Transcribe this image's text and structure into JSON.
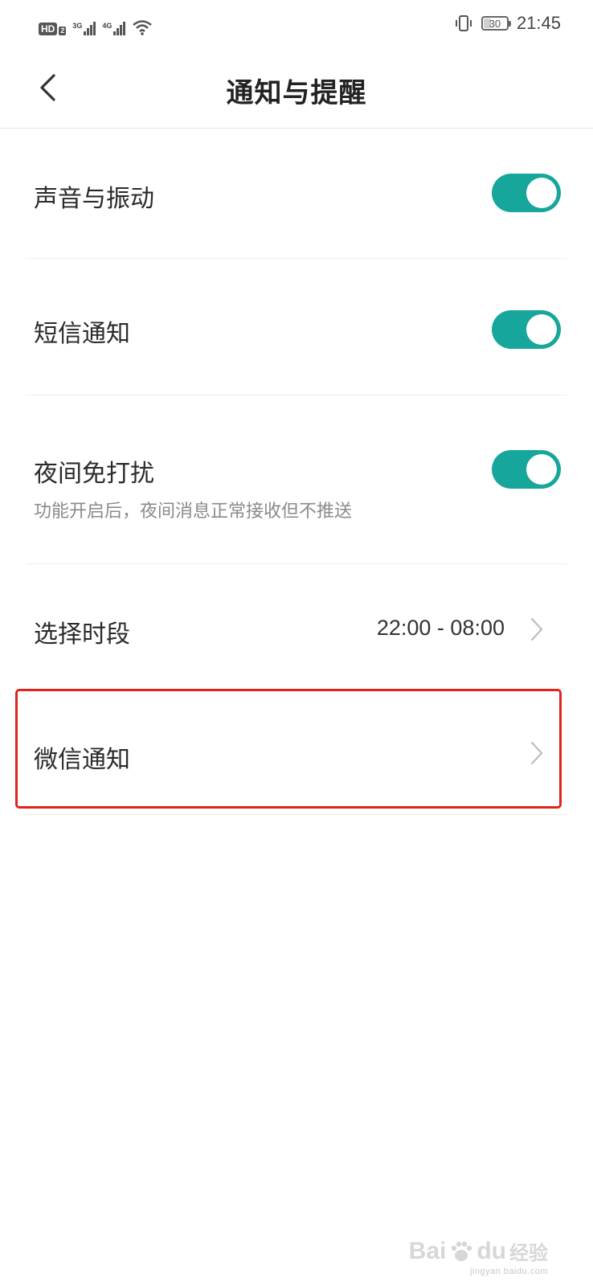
{
  "status_bar": {
    "hd": "HD",
    "hd_sub": "2",
    "net1": "3G",
    "net2": "4G",
    "battery": "30",
    "time": "21:45"
  },
  "header": {
    "title": "通知与提醒"
  },
  "rows": {
    "sound": {
      "label": "声音与振动",
      "enabled": true
    },
    "sms": {
      "label": "短信通知",
      "enabled": true
    },
    "dnd": {
      "label": "夜间免打扰",
      "subtitle": "功能开启后，夜间消息正常接收但不推送",
      "enabled": true
    },
    "period": {
      "label": "选择时段",
      "value": "22:00 - 08:00"
    },
    "wechat": {
      "label": "微信通知"
    }
  },
  "colors": {
    "toggle_on": "#17a69b",
    "highlight": "#e0241b"
  },
  "icons": [
    "back-arrow-icon",
    "vibrate-icon",
    "wifi-icon",
    "signal-icon",
    "chevron-right-icon"
  ],
  "watermark": {
    "brand": "Bai",
    "brand2": "du",
    "cn": "经验",
    "url": "jingyan.baidu.com"
  }
}
